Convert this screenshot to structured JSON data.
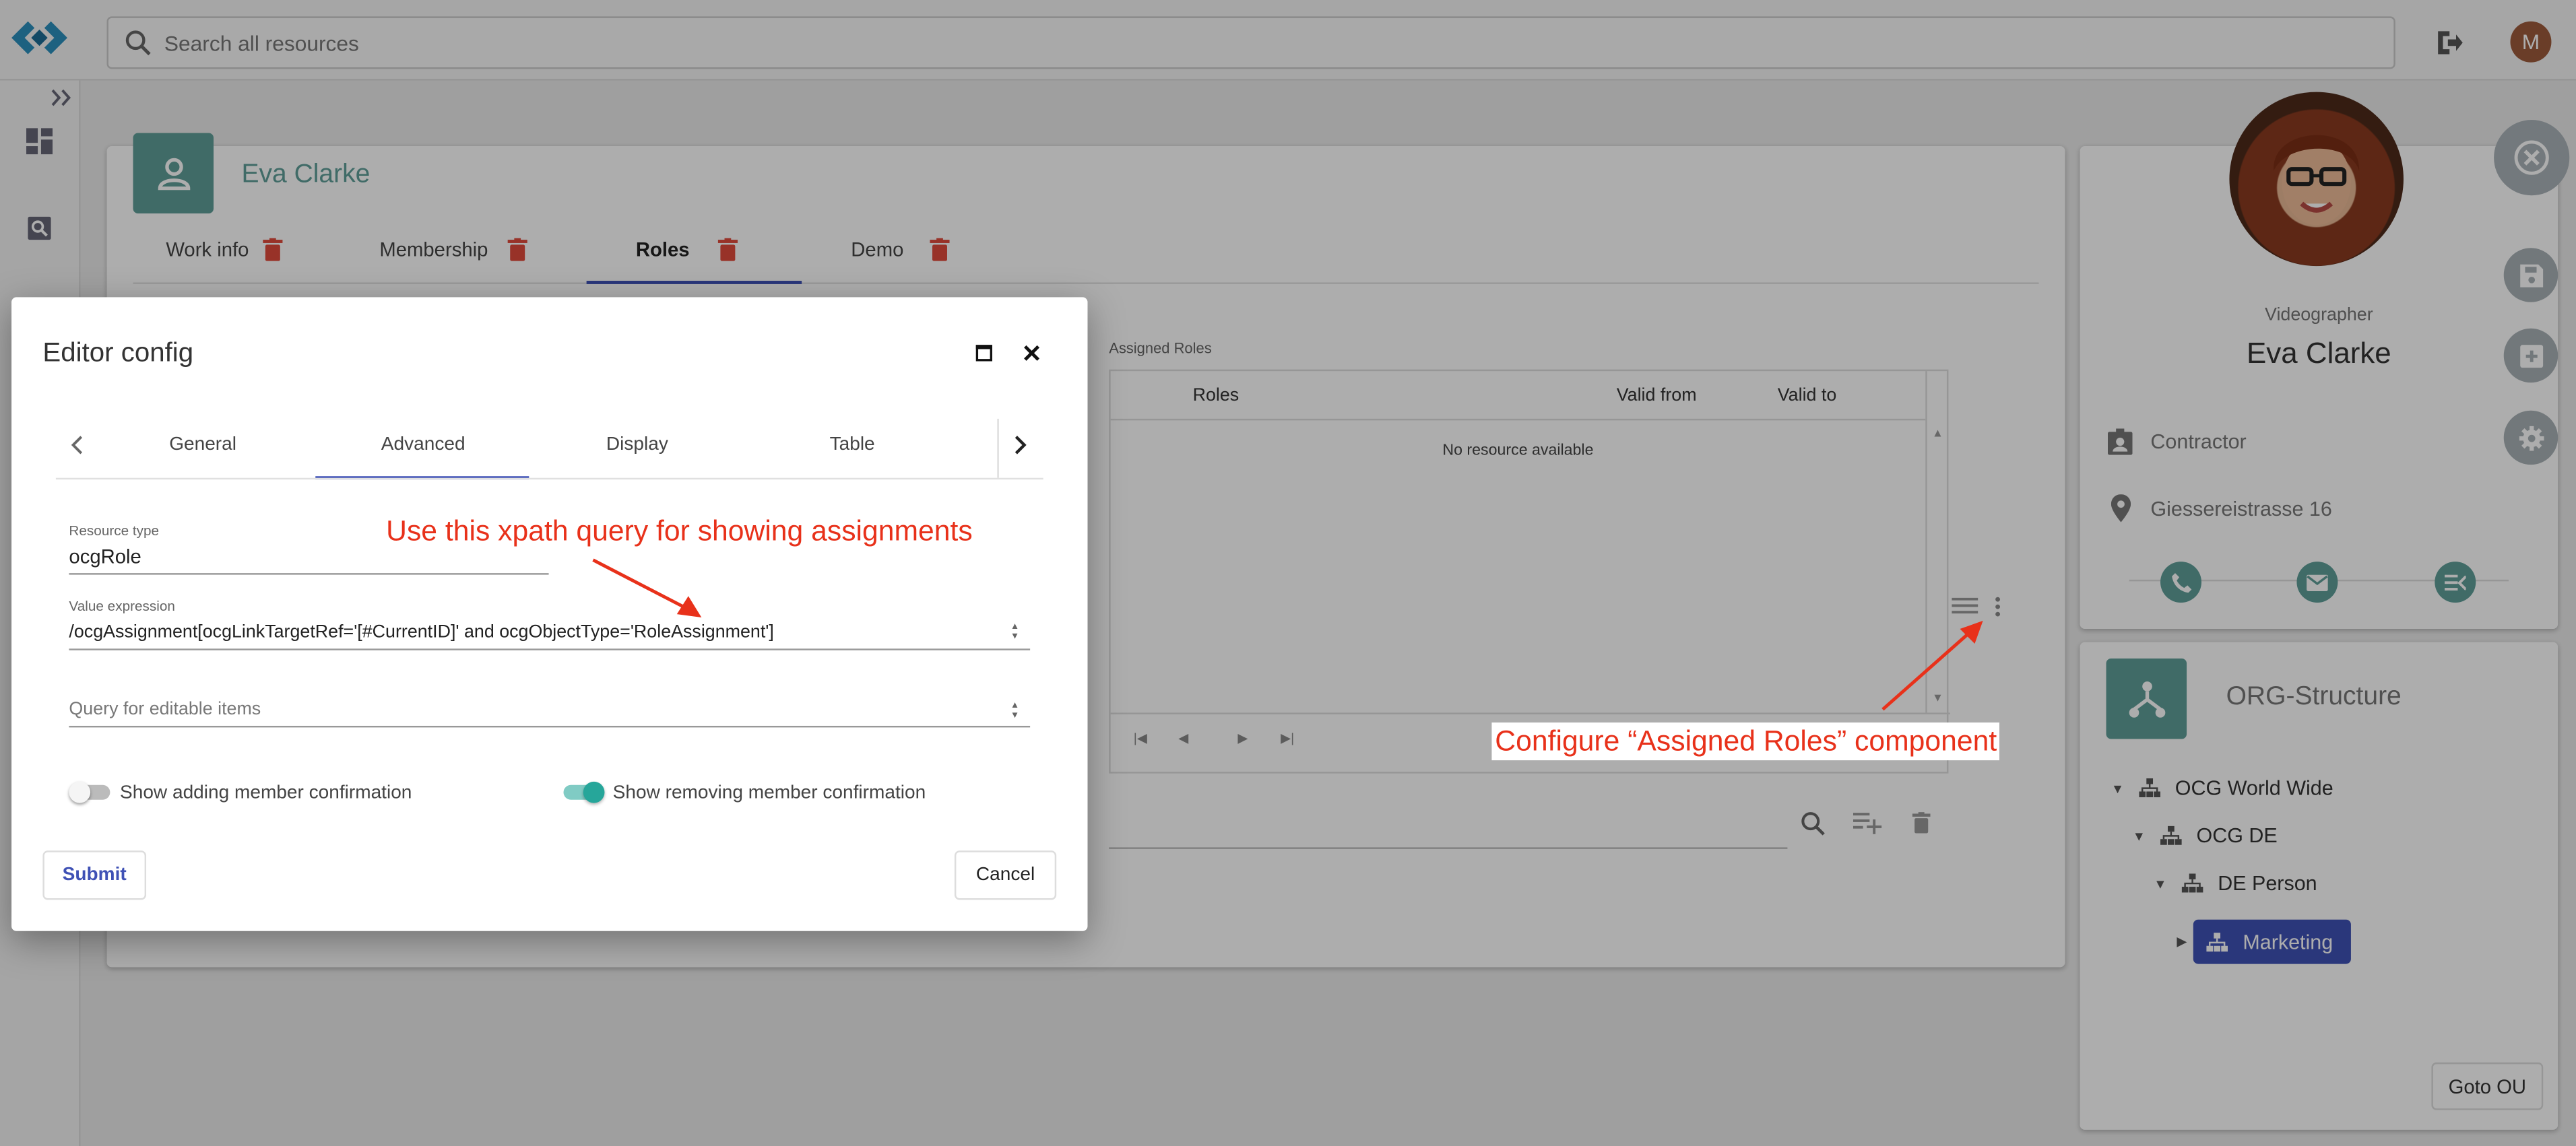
{
  "header": {
    "search_placeholder": "Search all resources",
    "avatar_letter": "M"
  },
  "person": {
    "name": "Eva Clarke",
    "tabs": [
      {
        "label": "Work info"
      },
      {
        "label": "Membership"
      },
      {
        "label": "Roles"
      },
      {
        "label": "Demo"
      }
    ],
    "active_tab": "Roles"
  },
  "assigned_roles": {
    "title": "Assigned Roles",
    "columns": [
      "Roles",
      "Valid from",
      "Valid to"
    ],
    "empty": "No resource available"
  },
  "profile": {
    "title": "Videographer",
    "name": "Eva Clarke",
    "type": "Contractor",
    "address": "Giessereistrasse 16"
  },
  "org": {
    "title": "ORG-Structure",
    "tree": [
      {
        "label": "OCG World Wide",
        "level": 0
      },
      {
        "label": "OCG DE",
        "level": 1
      },
      {
        "label": "DE Person",
        "level": 2
      },
      {
        "label": "Marketing",
        "level": 3,
        "selected": true
      }
    ],
    "goto_label": "Goto OU"
  },
  "dialog": {
    "title": "Editor config",
    "tabs": [
      {
        "label": "General"
      },
      {
        "label": "Advanced"
      },
      {
        "label": "Display"
      },
      {
        "label": "Table"
      }
    ],
    "active_tab": "Advanced",
    "resource_type_label": "Resource type",
    "resource_type_value": "ocgRole",
    "value_expression_label": "Value expression",
    "value_expression_value": "/ocgAssignment[ocgLinkTargetRef='[#CurrentID]' and  ocgObjectType='RoleAssignment']",
    "query_placeholder": "Query for editable items",
    "toggle_add_label": "Show adding member confirmation",
    "toggle_add_on": false,
    "toggle_remove_label": "Show removing member confirmation",
    "toggle_remove_on": true,
    "submit_label": "Submit",
    "cancel_label": "Cancel"
  },
  "annotations": {
    "xpath_note": "Use this xpath query for showing assignments",
    "component_note": "Configure “Assigned Roles” component"
  },
  "colors": {
    "teal": "#5f9e99",
    "primary": "#3f51b5",
    "annotation": "#e8311a",
    "toggle_on": "#26a69a"
  }
}
